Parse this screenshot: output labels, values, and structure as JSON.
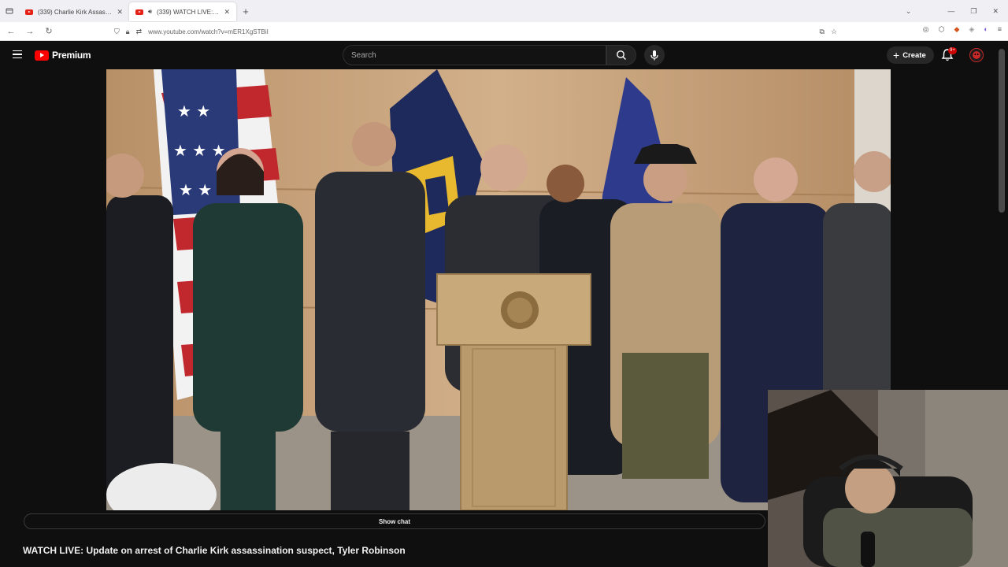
{
  "browser": {
    "tabs": [
      {
        "title": "(339) Charlie Kirk Assassination"
      },
      {
        "title": "(339) WATCH LIVE: Update on"
      }
    ],
    "url": "www.youtube.com/watch?v=mER1XgSTBiI"
  },
  "youtube": {
    "logo_text": "Premium",
    "search_placeholder": "Search",
    "create_label": "Create",
    "notification_count": "9+",
    "show_chat_label": "Show chat",
    "video_title": "WATCH LIVE: Update on arrest of Charlie Kirk assassination suspect, Tyler Robinson"
  },
  "colors": {
    "youtube_red": "#ff0000",
    "background": "#0f0f0f",
    "wall": "#c9a57c"
  },
  "icons": [
    "menu-icon",
    "search-icon",
    "mic-icon",
    "plus-icon",
    "bell-icon",
    "avatar-icon",
    "star-icon",
    "lock-icon",
    "close-icon"
  ]
}
